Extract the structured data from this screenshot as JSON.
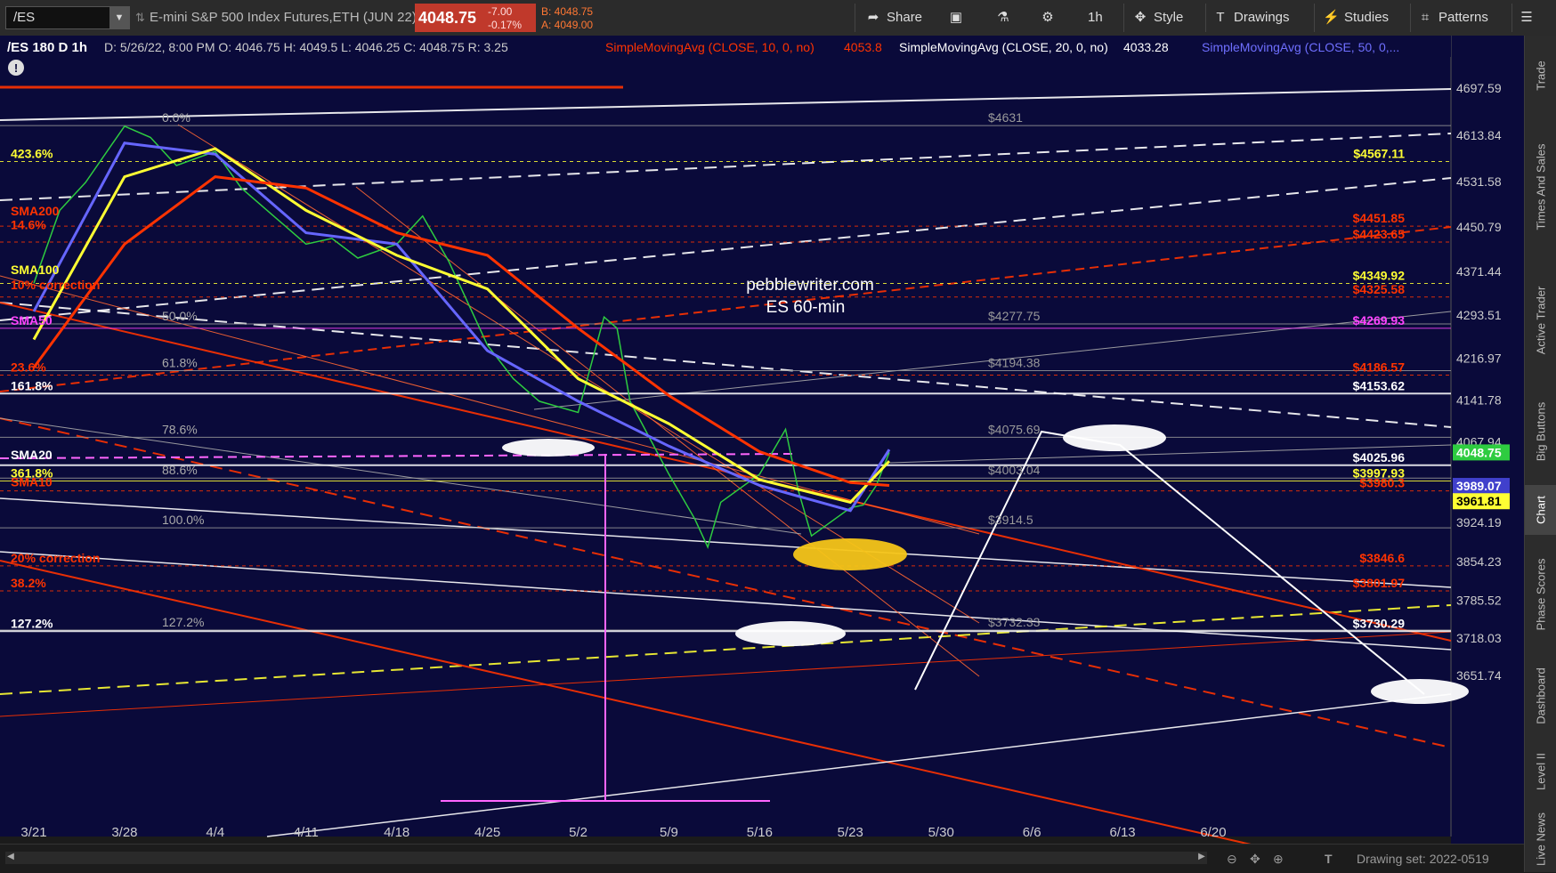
{
  "toolbar": {
    "symbol": "/ES",
    "description": "E-mini S&P 500 Index Futures,ETH (JUN 22)",
    "last": "4048.75",
    "change": "-7.00",
    "change_pct": "-0.17%",
    "bid": "B: 4048.75",
    "ask": "A: 4049.00",
    "share": "Share",
    "aggregation": "1h",
    "style": "Style",
    "drawings": "Drawings",
    "studies": "Studies",
    "patterns": "Patterns"
  },
  "header": {
    "title": "/ES 180 D 1h",
    "ohlc": "D: 5/26/22, 8:00 PM  O: 4046.75  H: 4049.5  L: 4046.25  C: 4048.75  R: 3.25",
    "sma10_label": "SimpleMovingAvg (CLOSE, 10, 0, no)",
    "sma10_value": "4053.8",
    "sma20_label": "SimpleMovingAvg (CLOSE, 20, 0, no)",
    "sma20_value": "4033.28",
    "sma50_label": "SimpleMovingAvg (CLOSE, 50, 0,..."
  },
  "chart_data": {
    "type": "line",
    "annotation": [
      "pebblewriter.com",
      "ES 60-min"
    ],
    "x_ticks": [
      "3/21",
      "3/28",
      "4/4",
      "4/11",
      "4/18",
      "4/25",
      "5/2",
      "5/9",
      "5/16",
      "5/23",
      "5/30",
      "6/6",
      "6/13",
      "6/20"
    ],
    "y_ticks": [
      4697.59,
      4613.84,
      4531.58,
      4450.79,
      4371.44,
      4293.51,
      4216.97,
      4141.78,
      4067.94,
      3924.19,
      3854.23,
      3785.52,
      3718.03,
      3651.74
    ],
    "ylim": [
      3600,
      4700
    ],
    "series": [
      {
        "name": "close",
        "color": "#2ecc40",
        "x": [
          "3/21",
          "3/23",
          "3/25",
          "3/28",
          "3/30",
          "4/1",
          "4/4",
          "4/6",
          "4/8",
          "4/11",
          "4/13",
          "4/15",
          "4/18",
          "4/20",
          "4/22",
          "4/25",
          "4/27",
          "4/29",
          "5/2",
          "5/4",
          "5/5",
          "5/6",
          "5/9",
          "5/11",
          "5/12",
          "5/13",
          "5/16",
          "5/18",
          "5/19",
          "5/20",
          "5/23",
          "5/24",
          "5/25",
          "5/26"
        ],
        "values": [
          4350,
          4480,
          4530,
          4630,
          4610,
          4560,
          4585,
          4520,
          4480,
          4420,
          4430,
          4395,
          4420,
          4470,
          4390,
          4240,
          4180,
          4140,
          4120,
          4290,
          4270,
          4140,
          4010,
          3930,
          3880,
          3960,
          4010,
          4090,
          3980,
          3900,
          3950,
          3955,
          3990,
          4048.75
        ]
      },
      {
        "name": "SMA10",
        "color": "#6666ff",
        "x": [
          "3/21",
          "3/28",
          "4/4",
          "4/11",
          "4/18",
          "4/25",
          "5/2",
          "5/9",
          "5/16",
          "5/23",
          "5/26"
        ],
        "values": [
          4300,
          4600,
          4580,
          4440,
          4420,
          4230,
          4140,
          4060,
          3990,
          3945,
          4053.8
        ]
      },
      {
        "name": "SMA20",
        "color": "#ffff33",
        "x": [
          "3/21",
          "3/28",
          "4/4",
          "4/11",
          "4/18",
          "4/25",
          "5/2",
          "5/9",
          "5/16",
          "5/23",
          "5/26"
        ],
        "values": [
          4250,
          4540,
          4590,
          4480,
          4400,
          4340,
          4180,
          4100,
          4000,
          3960,
          4033.28
        ]
      },
      {
        "name": "SMA50",
        "color": "#ff3300",
        "x": [
          "3/21",
          "3/28",
          "4/4",
          "4/11",
          "4/18",
          "4/25",
          "5/2",
          "5/9",
          "5/16",
          "5/23",
          "5/26"
        ],
        "values": [
          4200,
          4420,
          4540,
          4520,
          4440,
          4400,
          4270,
          4150,
          4050,
          3995,
          3990
        ]
      }
    ],
    "price_labels": [
      {
        "text": "$4631",
        "y": 4631,
        "color": "#999999"
      },
      {
        "text": "$4567.11",
        "y": 4567.11,
        "color": "#ffff33"
      },
      {
        "text": "$4451.85",
        "y": 4451.85,
        "color": "#ff3300"
      },
      {
        "text": "$4423.65",
        "y": 4423.65,
        "color": "#ff3300"
      },
      {
        "text": "$4349.92",
        "y": 4349.92,
        "color": "#ffff33"
      },
      {
        "text": "$4325.58",
        "y": 4325.58,
        "color": "#ff3300"
      },
      {
        "text": "$4277.75",
        "y": 4277.75,
        "color": "#999999"
      },
      {
        "text": "$4269.93",
        "y": 4269.93,
        "color": "#ff44ff"
      },
      {
        "text": "$4194.38",
        "y": 4194.38,
        "color": "#999999"
      },
      {
        "text": "$4186.57",
        "y": 4186.57,
        "color": "#ff3300"
      },
      {
        "text": "$4153.62",
        "y": 4153.62,
        "color": "#ffffff"
      },
      {
        "text": "$4075.69",
        "y": 4075.69,
        "color": "#999999"
      },
      {
        "text": "$4025.96",
        "y": 4025.96,
        "color": "#ffffff"
      },
      {
        "text": "$4003.04",
        "y": 4003.04,
        "color": "#999999"
      },
      {
        "text": "$3997.93",
        "y": 3997.93,
        "color": "#ffff33"
      },
      {
        "text": "$3980.3",
        "y": 3980.3,
        "color": "#ff3300"
      },
      {
        "text": "$3914.5",
        "y": 3914.5,
        "color": "#999999"
      },
      {
        "text": "$3846.6",
        "y": 3846.6,
        "color": "#ff3300"
      },
      {
        "text": "$3801.97",
        "y": 3801.97,
        "color": "#ff3300"
      },
      {
        "text": "$3732.33",
        "y": 3732.33,
        "color": "#999999"
      },
      {
        "text": "$3730.29",
        "y": 3730.29,
        "color": "#ffffff"
      }
    ],
    "left_labels": [
      {
        "text": "423.6%",
        "y": 4567.11,
        "color": "#ffff33"
      },
      {
        "text": "SMA200",
        "y": 4465,
        "color": "#ff3300"
      },
      {
        "text": "14.6%",
        "y": 4440,
        "color": "#ff3300"
      },
      {
        "text": "SMA100",
        "y": 4360,
        "color": "#ffff33"
      },
      {
        "text": "10% correction",
        "y": 4333,
        "color": "#ff3300"
      },
      {
        "text": "SMA50",
        "y": 4269.93,
        "color": "#ff44ff"
      },
      {
        "text": "23.6%",
        "y": 4186.57,
        "color": "#ff3300"
      },
      {
        "text": "161.8%",
        "y": 4153.62,
        "color": "#ffffff"
      },
      {
        "text": "SMA20",
        "y": 4030,
        "color": "#ffffff"
      },
      {
        "text": "361.8%",
        "y": 3997.93,
        "color": "#ffff33"
      },
      {
        "text": "SMA10",
        "y": 3982,
        "color": "#ff3300"
      },
      {
        "text": "20% correction",
        "y": 3846.6,
        "color": "#ff3300"
      },
      {
        "text": "38.2%",
        "y": 3801.97,
        "color": "#ff3300"
      },
      {
        "text": "127.2%",
        "y": 3730.29,
        "color": "#ffffff"
      }
    ],
    "fib_labels": [
      {
        "text": "0.0%",
        "y": 4631
      },
      {
        "text": "50.0%",
        "y": 4277.75
      },
      {
        "text": "61.8%",
        "y": 4194.38
      },
      {
        "text": "78.6%",
        "y": 4075.69
      },
      {
        "text": "88.6%",
        "y": 4003.04
      },
      {
        "text": "100.0%",
        "y": 3914.5
      },
      {
        "text": "127.2%",
        "y": 3732.33
      }
    ],
    "axis_tags": [
      {
        "text": "4048.75",
        "y": 4048.75,
        "bg": "#2ecc40",
        "fg": "#ffffff"
      },
      {
        "text": "3989.07",
        "y": 3989.07,
        "bg": "#4040cc",
        "fg": "#ffffff"
      },
      {
        "text": "3961.81",
        "y": 3961.81,
        "bg": "#ffff33",
        "fg": "#000000"
      }
    ]
  },
  "right_tabs": [
    "Trade",
    "Times And Sales",
    "Active Trader",
    "Big Buttons",
    "Chart",
    "Phase Scores",
    "Dashboard",
    "Level II",
    "Live News"
  ],
  "footer": {
    "drawing_set": "Drawing set: 2022-0519"
  }
}
